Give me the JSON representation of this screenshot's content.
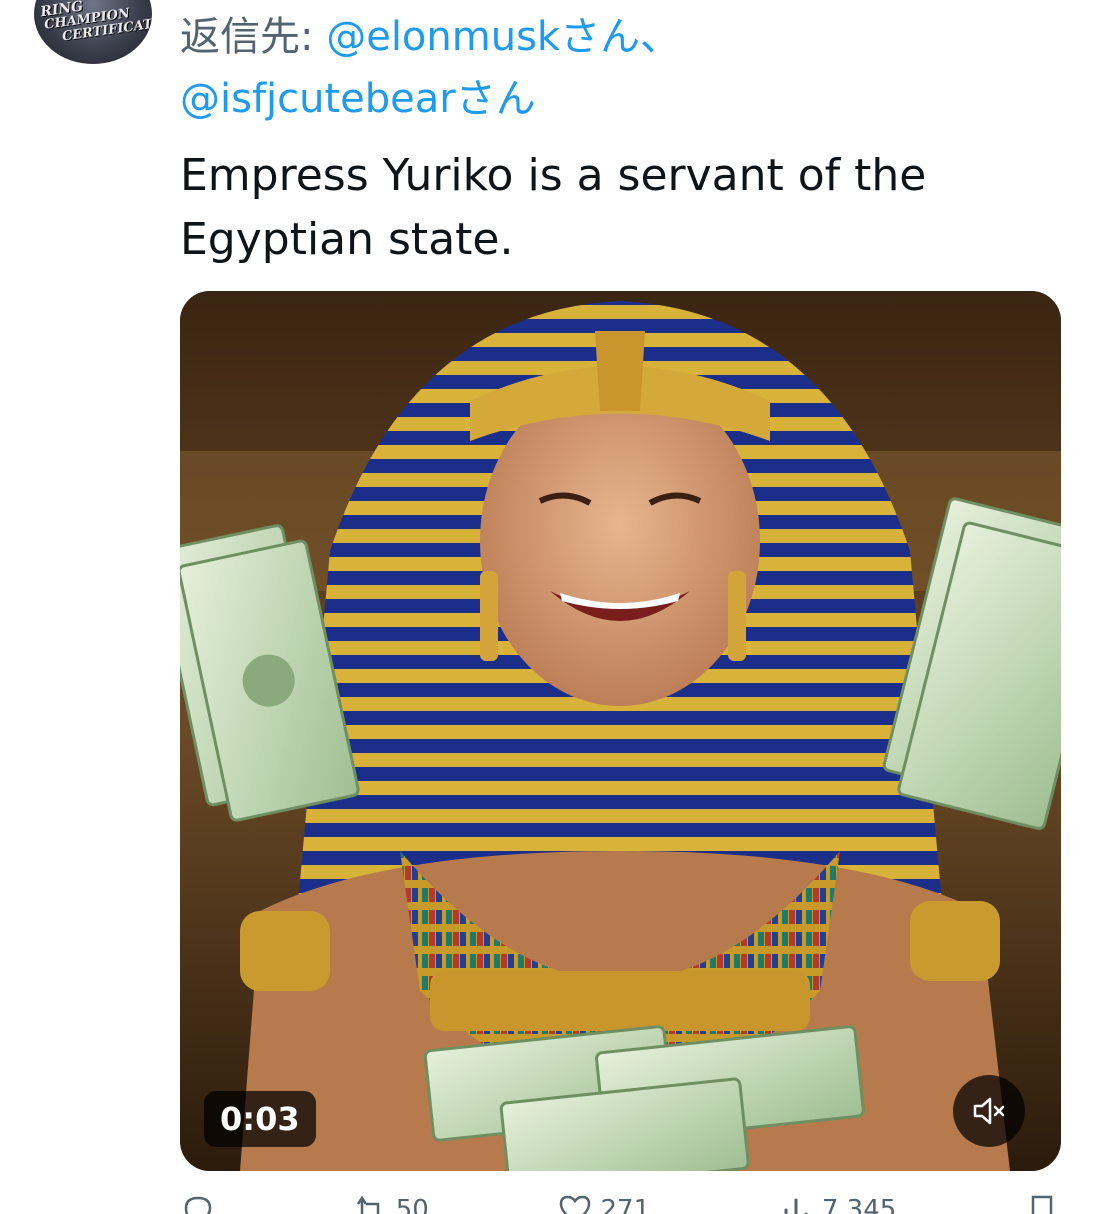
{
  "avatar": {
    "lines": [
      "RING",
      "CHAMPION",
      "CERTIFICAT"
    ]
  },
  "reply": {
    "prefix": "返信先: ",
    "mention_1": "@elonmuskさん",
    "separator": "、",
    "mention_2": "@isfjcutebearさん"
  },
  "tweet": {
    "text": "Empress Yuriko is a servant of the Egyptian state."
  },
  "video": {
    "duration": "0:03",
    "mute_icon": "volume-muted-icon"
  },
  "actions": {
    "reply_count": "",
    "retweet_count": "50",
    "like_count": "271",
    "views_count": "7,345"
  },
  "colors": {
    "mention": "#1d9bf0",
    "secondary_text": "#536471",
    "primary_text": "#0f1419"
  }
}
